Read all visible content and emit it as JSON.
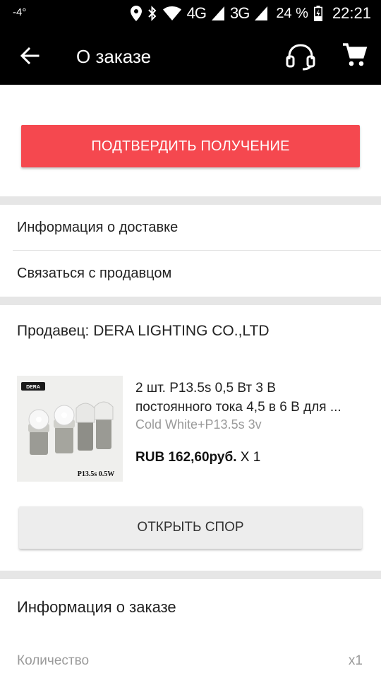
{
  "status_bar": {
    "temperature": "-4°",
    "network_4g": "4G",
    "network_3g": "3G",
    "battery": "24 %",
    "time": "22:21"
  },
  "app_bar": {
    "title": "О заказе",
    "icons": [
      "back-arrow-icon",
      "support-headset-icon",
      "cart-icon"
    ]
  },
  "actions": {
    "confirm_label": "ПОДТВЕРДИТЬ ПОЛУЧЕНИЕ",
    "confirm_color": "#f5484f"
  },
  "links": {
    "delivery_info": "Информация о доставке",
    "contact_seller": "Связаться с продавцом"
  },
  "order": {
    "seller": "Продавец: DERA LIGHTING CO.,LTD",
    "product": {
      "title_line1": "2 шт. P13.5s 0,5 Вт 3 В",
      "title_line2": "постоянного тока 4,5 в 6 В для ...",
      "variant": "Cold White+P13.5s 3v",
      "price": "RUB 162,60руб.",
      "quantity": "X 1",
      "image_brand": "DERA",
      "image_label": "P13.5s 0.5W"
    },
    "dispute_label": "ОТКРЫТЬ СПОР"
  },
  "order_info": {
    "title": "Информация о заказе",
    "quantity_label": "Количество",
    "quantity_value": "x1"
  }
}
